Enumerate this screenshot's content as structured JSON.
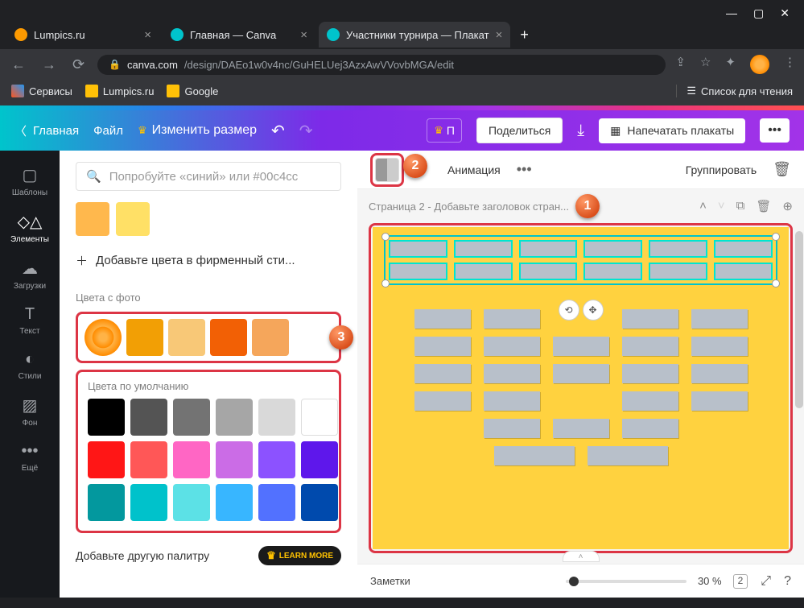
{
  "browser": {
    "tabs": [
      {
        "title": "Lumpics.ru",
        "favicon": "orange"
      },
      {
        "title": "Главная — Canva",
        "favicon": "canva"
      },
      {
        "title": "Участники турнира — Плакат",
        "favicon": "canva"
      }
    ],
    "url_domain": "canva.com",
    "url_path": "/design/DAEo1w0v4nc/GuHELUej3AzxAwVVovbMGA/edit",
    "bookmarks": {
      "services": "Сервисы",
      "lumpics": "Lumpics.ru",
      "google": "Google",
      "reading": "Список для чтения"
    }
  },
  "header": {
    "home": "Главная",
    "file": "Файл",
    "resize": "Изменить размер",
    "pro_char": "П",
    "share": "Поделиться",
    "print": "Напечатать плакаты"
  },
  "rail": {
    "templates": "Шаблоны",
    "elements": "Элементы",
    "uploads": "Загрузки",
    "text": "Текст",
    "styles": "Стили",
    "background": "Фон",
    "more": "Ещё"
  },
  "panel": {
    "search_placeholder": "Попробуйте «синий» или #00c4cc",
    "brand_add": "Добавьте цвета в фирменный сти...",
    "doc_colors": [
      "#ffb84d",
      "#ffe066"
    ],
    "photo_label": "Цвета с фото",
    "photo_colors": [
      "#f29f05",
      "#f8c877",
      "#f26005",
      "#f5a65b"
    ],
    "default_label": "Цвета по умолчанию",
    "default_rows": [
      [
        "#000000",
        "#545454",
        "#737373",
        "#a6a6a6",
        "#d9d9d9",
        "#ffffff"
      ],
      [
        "#ff1616",
        "#ff5757",
        "#ff66c4",
        "#cb6ce6",
        "#8c52ff",
        "#5e17eb"
      ],
      [
        "#03989e",
        "#00c2cb",
        "#5ce1e6",
        "#38b6ff",
        "#5271ff",
        "#004aad"
      ]
    ],
    "palette_add": "Добавьте другую палитру",
    "learn_more": "LEARN MORE"
  },
  "context": {
    "animation": "Анимация",
    "group": "Группировать"
  },
  "page": {
    "title": "Страница 2 - Добавьте заголовок стран..."
  },
  "footer": {
    "notes": "Заметки",
    "zoom": "30 %",
    "pages": "2"
  },
  "steps": {
    "s1": "1",
    "s2": "2",
    "s3": "3"
  }
}
